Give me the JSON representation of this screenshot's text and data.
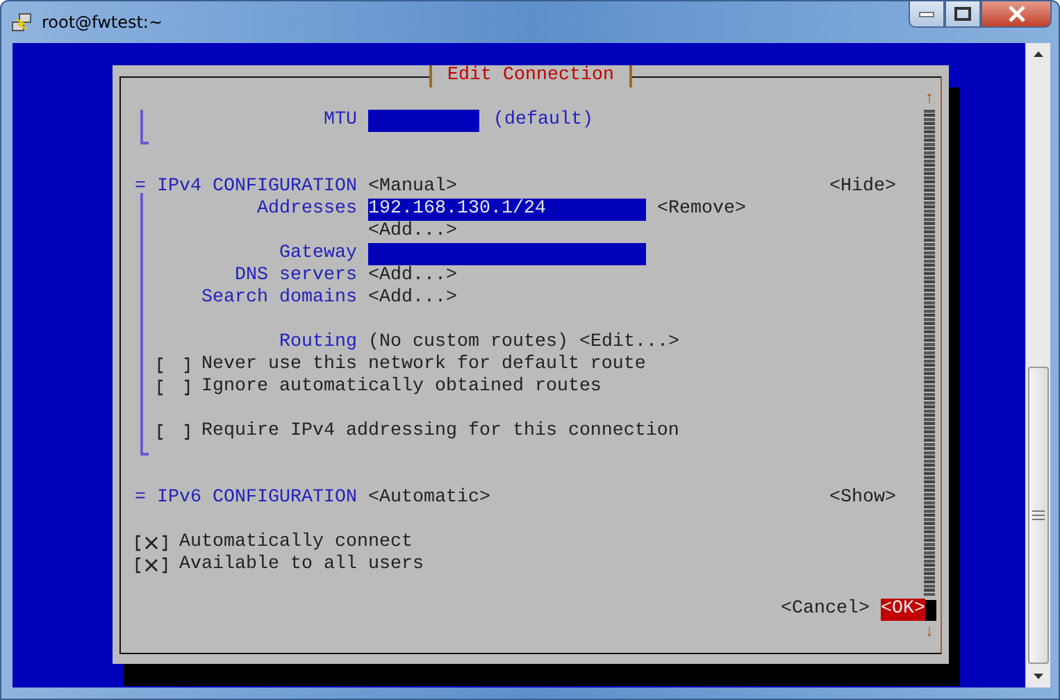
{
  "window": {
    "title": "root@fwtest:~"
  },
  "dialog": {
    "title": "Edit Connection",
    "scroll_up": "↑",
    "scroll_down": "↓",
    "mtu": {
      "label": "MTU",
      "note": "(default)"
    },
    "ipv4": {
      "marker": "=",
      "title": "IPv4 CONFIGURATION",
      "mode": "<Manual>",
      "toggle": "<Hide>",
      "rows": [
        {
          "kind": "field",
          "label": "Addresses",
          "value": "192.168.130.1/24",
          "action": "<Remove>"
        },
        {
          "kind": "action",
          "action": "<Add...>"
        },
        {
          "kind": "field",
          "label": "Gateway"
        },
        {
          "kind": "action",
          "label": "DNS servers",
          "action": "<Add...>"
        },
        {
          "kind": "action",
          "label": "Search domains",
          "action": "<Add...>"
        }
      ],
      "routing": {
        "label": "Routing",
        "value": "(No custom routes)",
        "action": "<Edit...>"
      },
      "options": [
        {
          "checked": false,
          "label": "Never use this network for default route"
        },
        {
          "checked": false,
          "label": "Ignore automatically obtained routes"
        }
      ],
      "require": {
        "checked": false,
        "label": "Require IPv4 addressing for this connection"
      }
    },
    "ipv6": {
      "marker": "=",
      "title": "IPv6 CONFIGURATION",
      "mode": "<Automatic>",
      "toggle": "<Show>"
    },
    "options": [
      {
        "checked": true,
        "label": "Automatically connect"
      },
      {
        "checked": true,
        "label": "Available to all users"
      }
    ],
    "buttons": [
      {
        "label": "<Cancel>",
        "selected": false
      },
      {
        "label": "<OK>",
        "selected": true
      }
    ]
  }
}
